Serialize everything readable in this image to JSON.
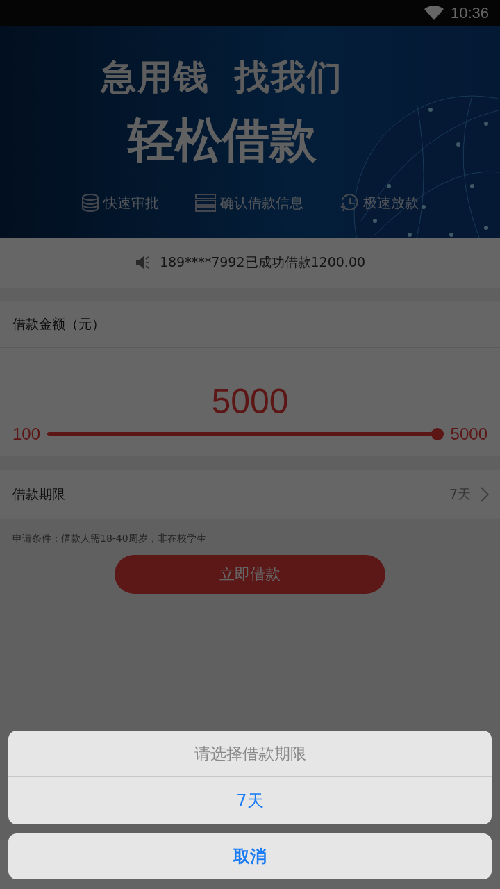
{
  "status_bar": {
    "time": "10:36"
  },
  "banner": {
    "headline": [
      "急用钱",
      "找我们"
    ],
    "title": "轻松借款",
    "features": [
      {
        "kind": "coins",
        "label": "快速审批"
      },
      {
        "kind": "list",
        "label": "确认借款信息"
      },
      {
        "kind": "clock",
        "label": "极速放款"
      }
    ]
  },
  "notice": {
    "text": "189****7992已成功借款1200.00"
  },
  "amount": {
    "label": "借款金额（元）",
    "value": "5000",
    "min": "100",
    "max": "5000",
    "level": 1
  },
  "term": {
    "label": "借款期限",
    "value": "7天"
  },
  "condition": "申请条件：借款人需18-40周岁，非在校学生",
  "submit": "立即借款",
  "picker": {
    "title": "请选择借款期限",
    "options": [
      "7天"
    ],
    "cancel": "取消"
  }
}
